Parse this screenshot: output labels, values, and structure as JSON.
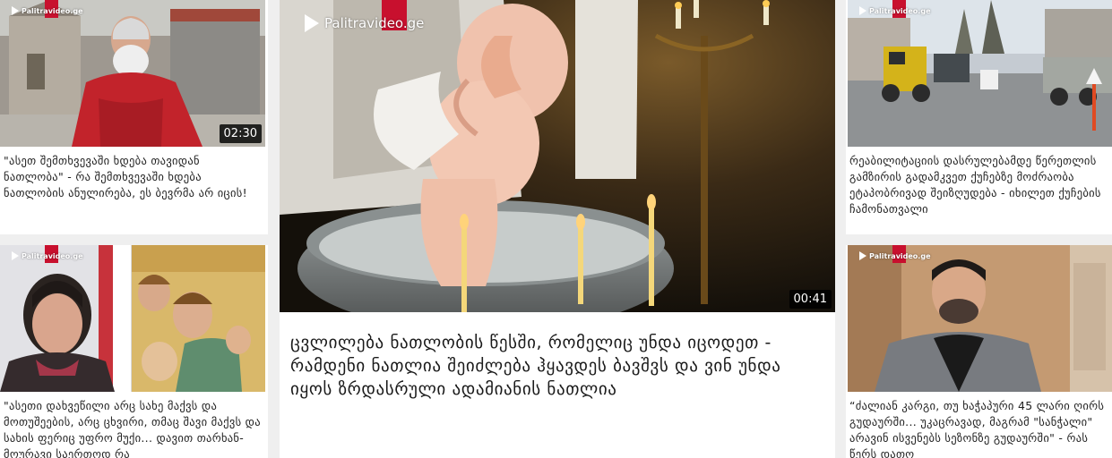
{
  "brand": {
    "logo_text": "Palitravideo.ge",
    "accent_color": "#c8102e"
  },
  "cards": {
    "top_left": {
      "title": "\"ასეთ შემთხვევაში ხდება თავიდან ნათლობა\" - რა შემთხვევაში ხდება ნათლობის ანულირება, ეს ბევრმა არ იცის!",
      "duration": "02:30",
      "image_alt": "bearded-priest-red-vestment-by-church"
    },
    "bottom_left": {
      "title": "\"ასეთი დახვეწილი არც სახე მაქვს და მოთუშეების, არც ცხვირი, თმაც შავი მაქვს და სახის ფერიც უფრო მუქი... დავით თარხან-მოურავი საერთოდ რა",
      "image_alt": "woman-portrait-and-icon-painting"
    },
    "center": {
      "title": "ცვლილება ნათლობის წესში, რომელიც უნდა იცოდეთ - რამდენი ნათლია შეიძლება ჰყავდეს ბავშვს და ვინ უნდა იყოს ზრდასრული ადამიანის ნათლია",
      "duration": "00:41",
      "image_alt": "baby-baptism-in-font-with-candles"
    },
    "top_right": {
      "title": "რეაბილიტაციის დასრულებამდე წერეთლის გამზირის გადამკვეთ ქუჩებზე მოძრაობა ეტაპობრივად შეიზღუდება - იხილეთ ქუჩების ჩამონათვალი",
      "image_alt": "street-roadworks-with-machinery"
    },
    "bottom_right": {
      "title": "“ძალიან კარგი, თუ ხაჭაპური 45 ლარი ღირს გუდაურში... უკაცრავად, მაგრამ \"სანჭალი\" არავინ ისვენებს სეზონზე გუდაურში\" - რას წერს დათო",
      "image_alt": "man-in-grey-jacket-portrait"
    }
  }
}
